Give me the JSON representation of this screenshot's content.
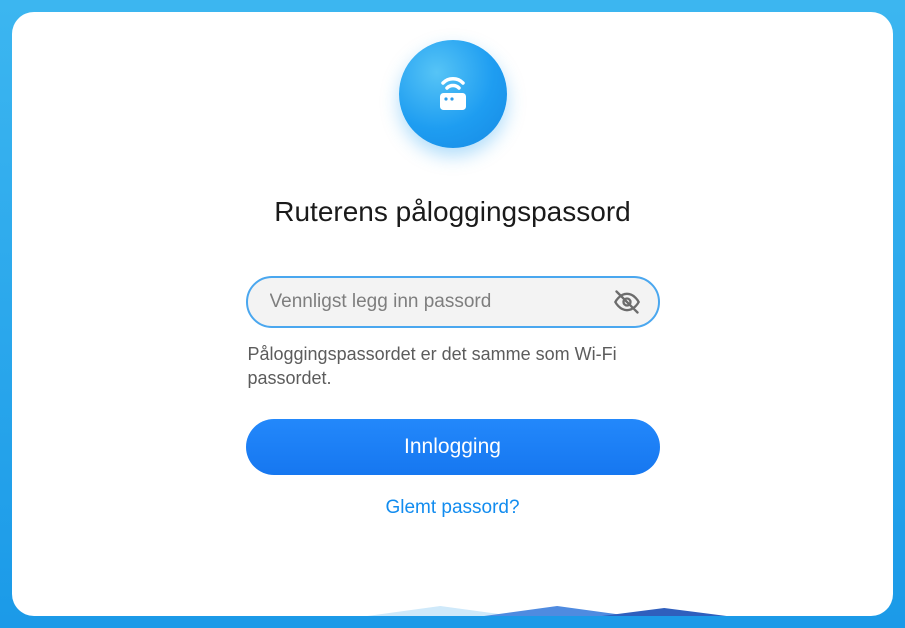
{
  "title": "Ruterens påloggingspassord",
  "password": {
    "placeholder": "Vennligst legg inn passord",
    "value": ""
  },
  "hint": "Påloggingspassordet er det samme som Wi-Fi passordet.",
  "login_label": "Innlogging",
  "forgot_label": "Glemt passord?"
}
